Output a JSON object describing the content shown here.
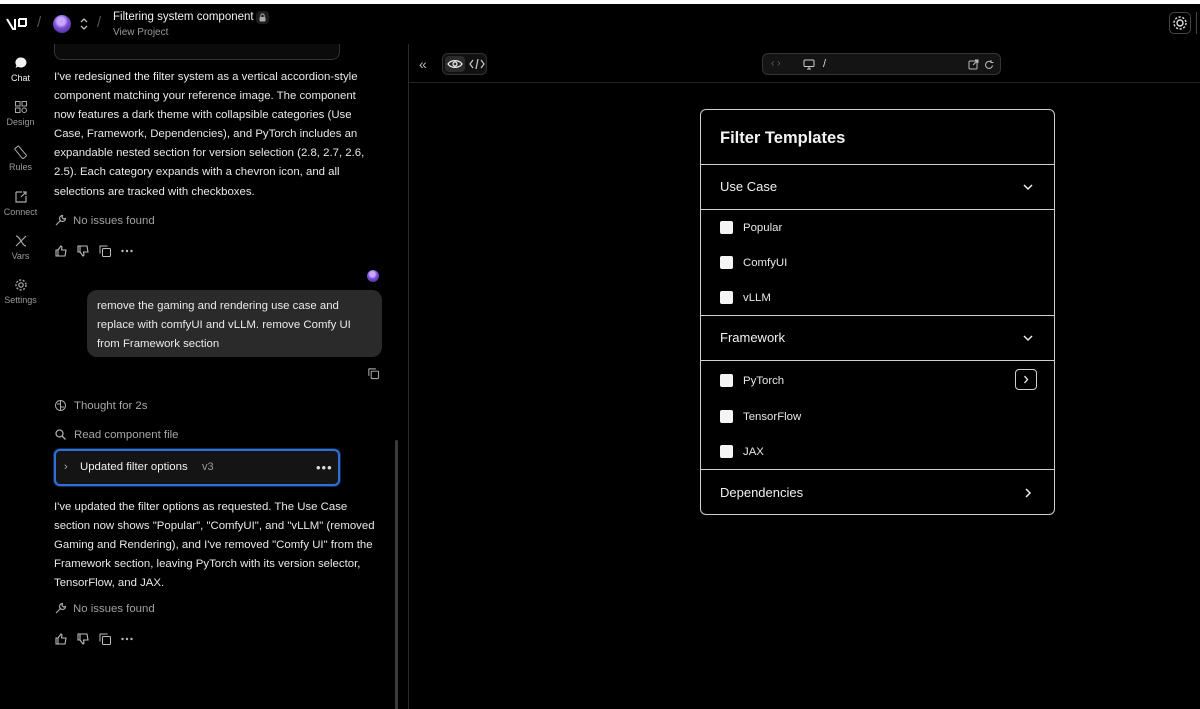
{
  "header": {
    "project_title": "Filtering system component",
    "project_subtitle": "View Project"
  },
  "rail": {
    "items": [
      {
        "label": "Chat",
        "icon": "chat-bubble-icon"
      },
      {
        "label": "Design",
        "icon": "design-grid-icon"
      },
      {
        "label": "Rules",
        "icon": "ruler-icon"
      },
      {
        "label": "Connect",
        "icon": "connect-icon"
      },
      {
        "label": "Vars",
        "icon": "variables-icon"
      },
      {
        "label": "Settings",
        "icon": "gear-icon"
      }
    ]
  },
  "chat": {
    "assistant_message_1": "I've redesigned the filter system as a vertical accordion-style component matching your reference image. The component now features a dark theme with collapsible categories (Use Case, Framework, Dependencies), and PyTorch includes an expandable nested section for version selection (2.8, 2.7, 2.6, 2.5). Each category expands with a chevron icon, and all selections are tracked with checkboxes.",
    "status_1": "No issues found",
    "user_message": "remove the gaming and rendering use case and replace with comfyUI and vLLM. remove Comfy UI from Framework section",
    "thought": "Thought for 2s",
    "tool_step": "Read component file",
    "version_card": {
      "title": "Updated filter options",
      "version": "v3"
    },
    "assistant_message_2": "I've updated the filter options as requested. The Use Case section now shows \"Popular\", \"ComfyUI\", and \"vLLM\" (removed Gaming and Rendering), and I've removed \"Comfy UI\" from the Framework section, leaving PyTorch with its version selector, TensorFlow, and JAX.",
    "status_2": "No issues found"
  },
  "preview": {
    "url_path": "/",
    "panel": {
      "title": "Filter Templates",
      "sections": [
        {
          "name": "Use Case",
          "expanded": true,
          "options": [
            "Popular",
            "ComfyUI",
            "vLLM"
          ]
        },
        {
          "name": "Framework",
          "expanded": true,
          "options": [
            "PyTorch",
            "TensorFlow",
            "JAX"
          ]
        },
        {
          "name": "Dependencies",
          "expanded": false,
          "options": []
        }
      ]
    }
  },
  "colors": {
    "background": "#000000",
    "accent_focus": "#2f6fd6",
    "panel_border": "#cfcfcf"
  }
}
